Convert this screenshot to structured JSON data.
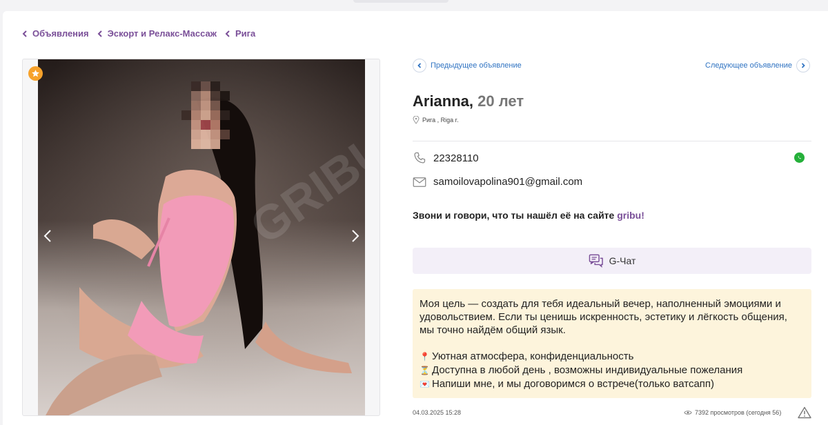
{
  "breadcrumb": [
    "Объявления",
    "Эскорт и Релакс-Массаж",
    "Рига"
  ],
  "gallery": {
    "photo_alt": "Фото",
    "watermark": "GRIBU"
  },
  "ad_nav": {
    "prev_label": "Предыдущее объявление",
    "next_label": "Следующее объявление"
  },
  "profile": {
    "name": "Arianna,",
    "age": "20 лет",
    "location": "Рига ,  Riga r."
  },
  "contacts": {
    "phone": "22328110",
    "email": "samoilovapolina901@gmail.com"
  },
  "promo": {
    "text": "Звони и говори, что ты нашёл её на сайте ",
    "brand": "gribu",
    "suffix": "!"
  },
  "chat": {
    "label": "G-Чат"
  },
  "description": {
    "intro": "Моя цель — создать для тебя идеальный вечер, наполненный эмоциями и удовольствием. Если ты ценишь искренность, эстетику и лёгкость общения, мы точно найдём общий язык.",
    "items": [
      {
        "icon": "📍",
        "text": "Уютная атмосфера, конфиденциальность"
      },
      {
        "icon": "⏳",
        "text": "Доступна в любой день , возможны индивидуальные пожелания"
      },
      {
        "icon": "💌",
        "text": "Напиши мне, и мы договоримся о встрече(только ватсапп)"
      }
    ]
  },
  "footer": {
    "date": "04.03.2025 15:28",
    "views": "7392 просмотров (сегодня 56)"
  },
  "colors": {
    "brand": "#7a4f98",
    "link": "#2f73c2",
    "desc_bg": "#fdf4dc",
    "chat_bg": "#f3eff8",
    "badge": "#f7a22b",
    "whatsapp": "#25b03a"
  }
}
